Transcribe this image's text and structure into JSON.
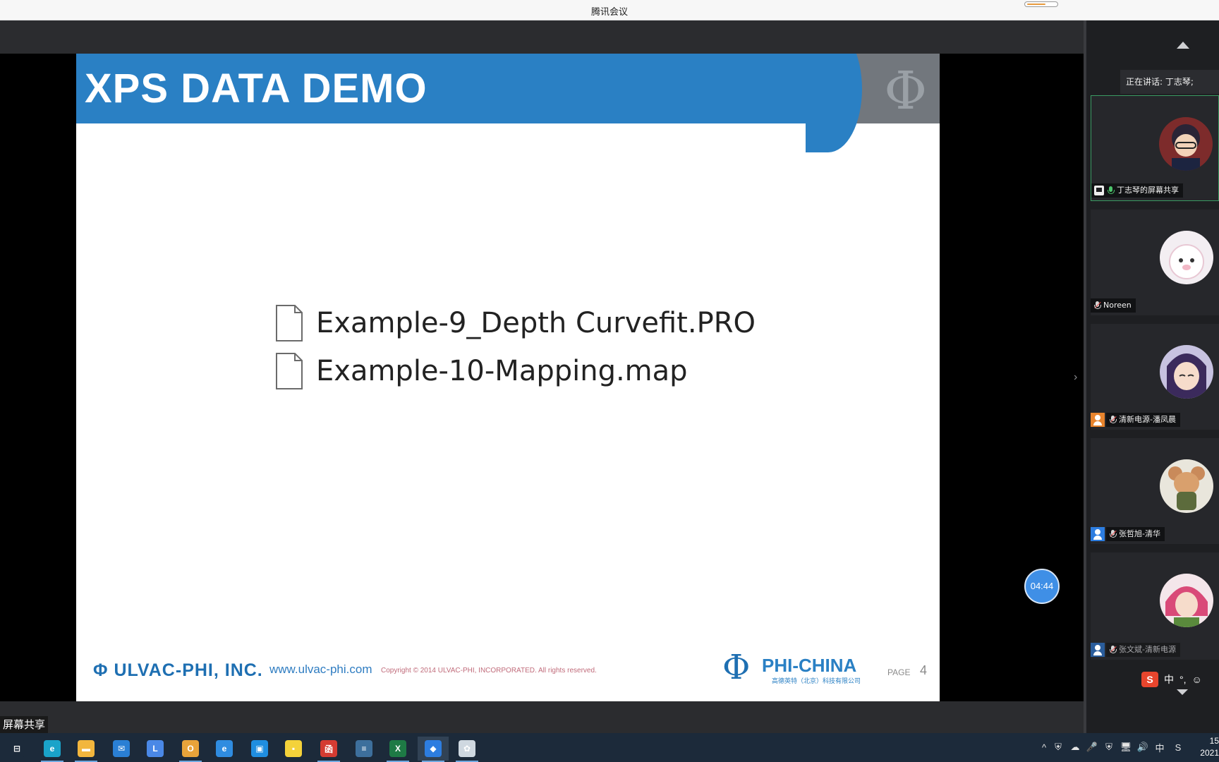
{
  "window": {
    "title": "腾讯会议"
  },
  "slide": {
    "header_title": "XPS DATA DEMO",
    "files": [
      {
        "name": "Example-9_Depth Curvefit.PRO"
      },
      {
        "name": "Example-10-Mapping.map"
      }
    ],
    "footer": {
      "company": "Φ ULVAC-PHI, INC.",
      "website": "www.ulvac-phi.com",
      "copyright": "Copyright © 2014 ULVAC-PHI, INCORPORATED. All rights reserved.",
      "brand": "PHI-CHINA",
      "brand_sub": "高德英特（北京）科技有限公司",
      "page_label": "PAGE",
      "page_number": "4"
    }
  },
  "timer": {
    "value": "04:44"
  },
  "panel": {
    "speaking": "正在讲话: 丁志琴;",
    "participants": [
      {
        "label": "丁志琴的屏幕共享",
        "avatar": "anime-detective-avatar",
        "sharing": true,
        "mic": "on"
      },
      {
        "label": "Noreen",
        "avatar": "white-cat-avatar",
        "mic": "off"
      },
      {
        "label": "清新电源-潘凤晨",
        "avatar": "anime-girl-avatar",
        "mic": "off",
        "badge": "orange"
      },
      {
        "label": "张哲旭-清华",
        "avatar": "mouse-toy-avatar",
        "mic": "off",
        "badge": "blue"
      },
      {
        "label": "张文斌-清新电源",
        "avatar": "pink-hair-avatar",
        "mic": "off",
        "badge": "blue"
      }
    ],
    "ime": {
      "lang": "中",
      "symbols": "°,"
    }
  },
  "share_label": "屏幕共享",
  "taskbar": {
    "apps": [
      {
        "name": "task-view",
        "color": "#1c2a3a",
        "glyph": "⊟"
      },
      {
        "name": "edge",
        "color": "#1aa3c9",
        "glyph": "e"
      },
      {
        "name": "file-explorer",
        "color": "#f2b63d",
        "glyph": "▬"
      },
      {
        "name": "mail",
        "color": "#2a7fd4",
        "glyph": "✉"
      },
      {
        "name": "lync",
        "color": "#4a88e6",
        "glyph": "L"
      },
      {
        "name": "outlook",
        "color": "#e8a33a",
        "glyph": "O"
      },
      {
        "name": "internet-explorer",
        "color": "#2f8ce0",
        "glyph": "e"
      },
      {
        "name": "store",
        "color": "#1f8ee0",
        "glyph": "▣"
      },
      {
        "name": "sticky-notes",
        "color": "#f4d23a",
        "glyph": "▪"
      },
      {
        "name": "app-red",
        "color": "#d43b32",
        "glyph": "函"
      },
      {
        "name": "scanner",
        "color": "#3d6f9c",
        "glyph": "≡"
      },
      {
        "name": "excel",
        "color": "#1e7a45",
        "glyph": "X"
      },
      {
        "name": "tencent-meeting",
        "color": "#2d7de0",
        "glyph": "◆"
      },
      {
        "name": "settings-app",
        "color": "#cfd8e0",
        "glyph": "✿"
      }
    ],
    "tray": [
      "^",
      "⛨",
      "☁",
      "🎤",
      "⛨",
      "🖥",
      "🔊",
      "中",
      "S"
    ],
    "clock_time": "15",
    "clock_date": "2021"
  }
}
